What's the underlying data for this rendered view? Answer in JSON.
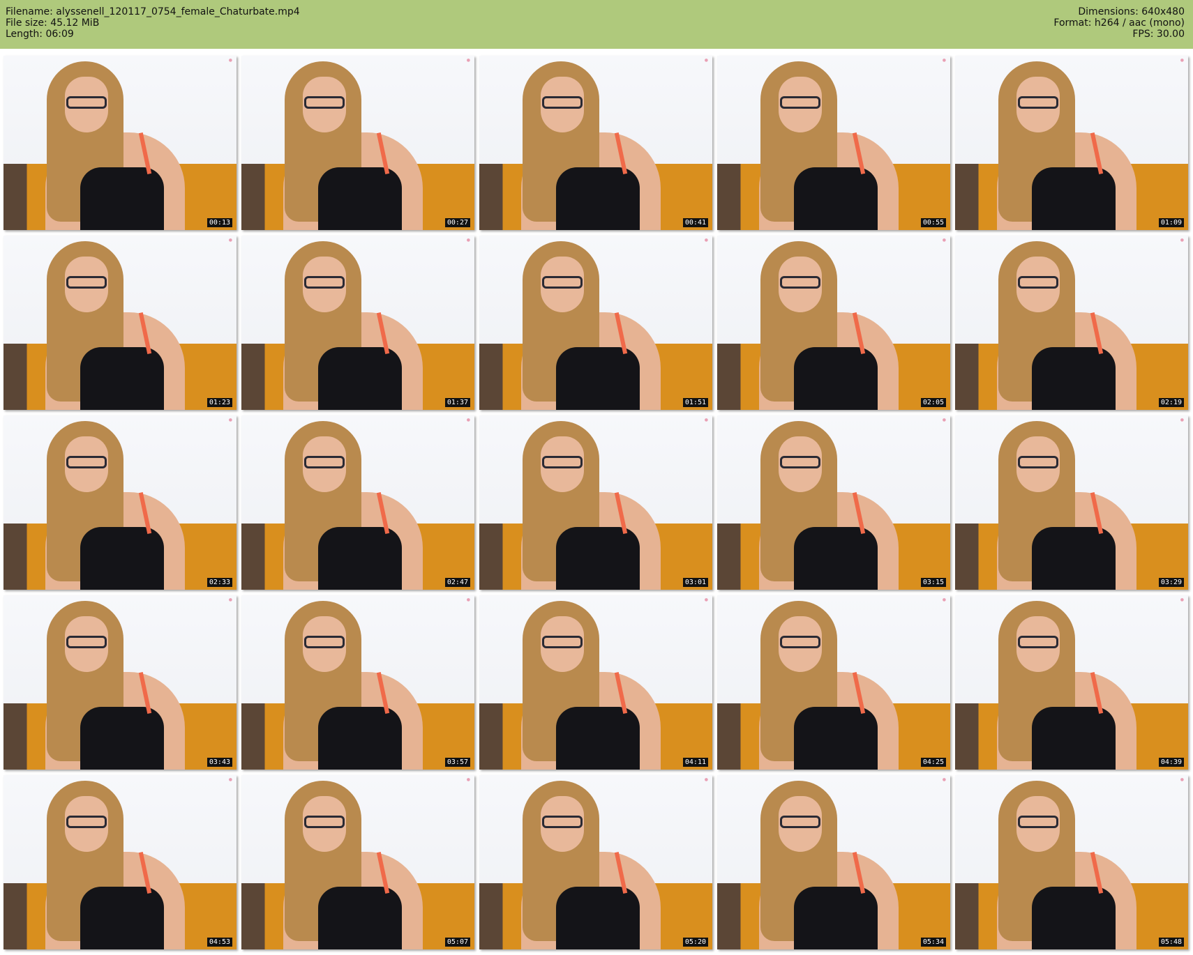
{
  "header": {
    "filename": "Filename: alyssenell_120117_0754_female_Chaturbate.mp4",
    "filesize": "File size: 45.12 MiB",
    "length": "Length: 06:09",
    "dimensions": "Dimensions: 640x480",
    "format": "Format: h264 / aac (mono)",
    "fps": "FPS: 30.00"
  },
  "thumbnails": [
    {
      "time": "00:13"
    },
    {
      "time": "00:27"
    },
    {
      "time": "00:41"
    },
    {
      "time": "00:55"
    },
    {
      "time": "01:09"
    },
    {
      "time": "01:23"
    },
    {
      "time": "01:37"
    },
    {
      "time": "01:51"
    },
    {
      "time": "02:05"
    },
    {
      "time": "02:19"
    },
    {
      "time": "02:33"
    },
    {
      "time": "02:47"
    },
    {
      "time": "03:01"
    },
    {
      "time": "03:15"
    },
    {
      "time": "03:29"
    },
    {
      "time": "03:43"
    },
    {
      "time": "03:57"
    },
    {
      "time": "04:11"
    },
    {
      "time": "04:25"
    },
    {
      "time": "04:39"
    },
    {
      "time": "04:53"
    },
    {
      "time": "05:07"
    },
    {
      "time": "05:20"
    },
    {
      "time": "05:34"
    },
    {
      "time": "05:48"
    }
  ]
}
